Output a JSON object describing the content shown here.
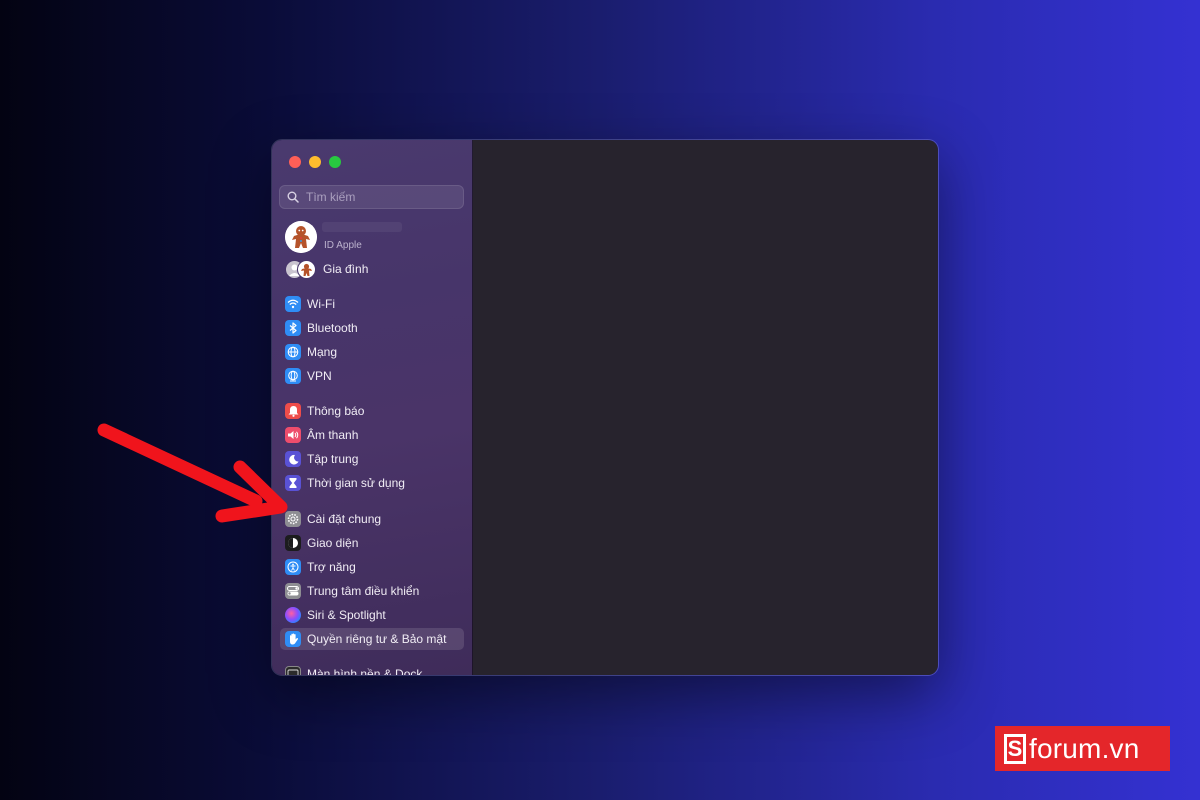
{
  "search": {
    "placeholder": "Tìm kiếm"
  },
  "account": {
    "subtitle": "ID Apple"
  },
  "family": {
    "label": "Gia đình"
  },
  "sidebar": {
    "items": [
      {
        "label": "Wi-Fi",
        "icon": "wifi-icon",
        "color": "#2f8df5"
      },
      {
        "label": "Bluetooth",
        "icon": "bluetooth-icon",
        "color": "#2f8df5"
      },
      {
        "label": "Mạng",
        "icon": "globe-icon",
        "color": "#2f8df5"
      },
      {
        "label": "VPN",
        "icon": "vpn-globe-icon",
        "color": "#2f8df5"
      },
      {
        "label": "Thông báo",
        "icon": "bell-icon",
        "color": "#ee4d4a"
      },
      {
        "label": "Âm thanh",
        "icon": "speaker-icon",
        "color": "#ee4d6c"
      },
      {
        "label": "Tập trung",
        "icon": "moon-icon",
        "color": "#5a52d5"
      },
      {
        "label": "Thời gian sử dụng",
        "icon": "hourglass-icon",
        "color": "#5a52d5"
      },
      {
        "label": "Cài đặt chung",
        "icon": "gear-icon",
        "color": "#8e8e93"
      },
      {
        "label": "Giao diện",
        "icon": "appearance-icon",
        "color": "#1c1c1e"
      },
      {
        "label": "Trợ năng",
        "icon": "accessibility-icon",
        "color": "#2f8df5"
      },
      {
        "label": "Trung tâm điều khiển",
        "icon": "control-center-icon",
        "color": "#8e8e93"
      },
      {
        "label": "Siri & Spotlight",
        "icon": "siri-icon",
        "color": "#6b4fd8"
      },
      {
        "label": "Quyền riêng tư & Bảo mật",
        "icon": "hand-icon",
        "color": "#2f8df5",
        "selected": true
      },
      {
        "label": "Màn hình nền & Dock",
        "icon": "dock-icon",
        "color": "#2b2b2b"
      }
    ]
  },
  "watermark": {
    "s": "S",
    "text": "forum.vn"
  },
  "colors": {
    "annotation_arrow": "#f0141c",
    "brand": "#e4262a"
  }
}
